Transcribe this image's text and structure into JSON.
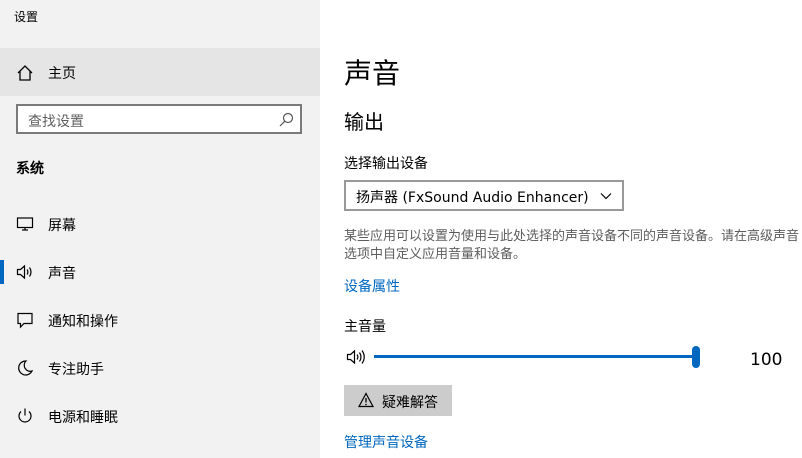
{
  "window": {
    "title": "设置"
  },
  "sidebar": {
    "home_label": "主页",
    "search_placeholder": "查找设置",
    "section_title": "系统",
    "items": [
      {
        "label": "屏幕",
        "icon": "monitor-icon"
      },
      {
        "label": "声音",
        "icon": "speaker-icon",
        "active": true
      },
      {
        "label": "通知和操作",
        "icon": "notification-icon"
      },
      {
        "label": "专注助手",
        "icon": "moon-icon"
      },
      {
        "label": "电源和睡眠",
        "icon": "power-icon"
      }
    ]
  },
  "main": {
    "page_title": "声音",
    "output_title": "输出",
    "select_label": "选择输出设备",
    "selected_device": "扬声器 (FxSound Audio Enhancer)",
    "description": "某些应用可以设置为使用与此处选择的声音设备不同的声音设备。请在高级声音选项中自定义应用音量和设备。",
    "device_properties_link": "设备属性",
    "volume_label": "主音量",
    "volume_value": "100",
    "troubleshoot_label": "疑难解答",
    "manage_devices_link": "管理声音设备"
  },
  "colors": {
    "accent": "#0067c0",
    "sidebar_bg": "#f2f2f2",
    "home_bg": "#e5e5e5",
    "button_bg": "#cccccc"
  }
}
